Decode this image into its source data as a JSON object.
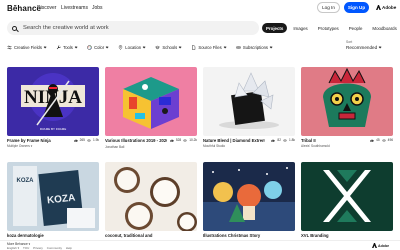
{
  "header": {
    "logo": "Bēhance",
    "nav": [
      "Discover",
      "Livestreams",
      "Jobs"
    ],
    "login_label": "Log In",
    "signup_label": "Sign Up",
    "adobe_label": "Adobe"
  },
  "search": {
    "placeholder": "Search the creative world at work"
  },
  "tabs": [
    "Projects",
    "Images",
    "Prototypes",
    "People",
    "Moodboards"
  ],
  "filters": [
    {
      "label": "Creative Fields",
      "icon": "sliders-icon"
    },
    {
      "label": "Tools",
      "icon": "wrench-icon"
    },
    {
      "label": "Color",
      "icon": "palette-icon"
    },
    {
      "label": "Location",
      "icon": "location-icon"
    },
    {
      "label": "Schools",
      "icon": "school-icon"
    },
    {
      "label": "Source Files",
      "icon": "file-icon"
    },
    {
      "label": "Subscriptions",
      "icon": "subscription-icon"
    }
  ],
  "sort": {
    "label": "Sort",
    "value": "Recommended"
  },
  "projects": [
    {
      "title": "Frame by Frame Ninja",
      "owner": "Multiple Owners ▾",
      "likes": "265",
      "views": "1.9k"
    },
    {
      "title": "Various Illustrations 2019 - 2020 ✌",
      "owner": "Jonathan Ball",
      "likes": "528",
      "views": "10.2k"
    },
    {
      "title": "Nature Blend | Diamond Extreme Collection",
      "owner": "Mouthful Studio",
      "likes": "82",
      "views": "1.8k"
    },
    {
      "title": "Tribal II",
      "owner": "Alexis' Southhamold",
      "likes": "45",
      "views": "496"
    },
    {
      "title": "koza dermatologie",
      "owner": "",
      "likes": "",
      "views": ""
    },
    {
      "title": "coconut, traditional and",
      "owner": "",
      "likes": "",
      "views": ""
    },
    {
      "title": "Illustrations Christmas Story",
      "owner": "",
      "likes": "",
      "views": ""
    },
    {
      "title": "XVL Branding",
      "owner": "",
      "likes": "",
      "views": ""
    }
  ],
  "footer": {
    "brand": "More Behance ▾",
    "links": [
      "English ▾",
      "TOU",
      "Privacy",
      "Community",
      "Help"
    ],
    "adobe_label": "Adobe"
  }
}
